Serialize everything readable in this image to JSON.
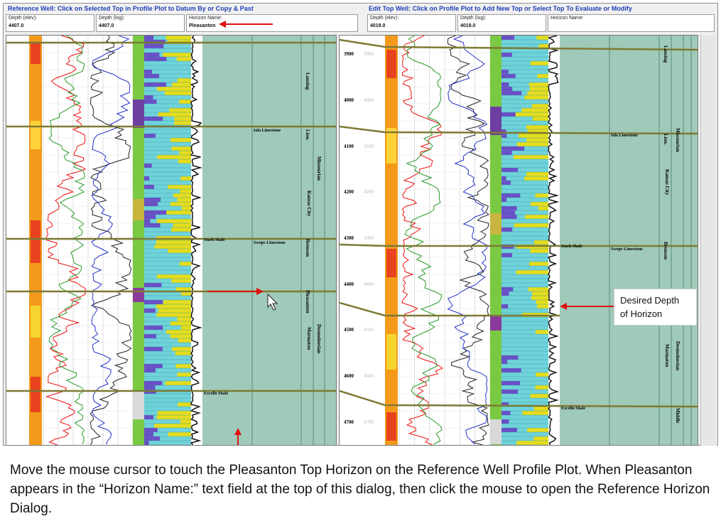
{
  "reference_well": {
    "title": "Reference Well: Click on Selected Top in Profile Plot to Datum By or Copy & Past",
    "depth_elev_label": "Depth (elev):",
    "depth_elev_value": "4407.0",
    "depth_log_label": "Depth (log):",
    "depth_log_value": "4407.0",
    "horizon_label": "Horizon Name:",
    "horizon_value": "Pleasanton",
    "formation_labels": [
      "Iola Limestone",
      "Stark Shale",
      "Swope Limestone",
      "Excello Shale"
    ],
    "vertical_labels": [
      "Lansing",
      "Lion.",
      "Missourian",
      "Kansas City",
      "Bronson",
      "Pleasanton",
      "Desmoinesian",
      "Marmaton"
    ]
  },
  "edit_top_well": {
    "title": "Edit Top Well: Click on Profile Plot to Add New Top or Select Top To Evaluate or Modify",
    "depth_elev_label": "Depth (elev):",
    "depth_elev_value": "4019.0",
    "depth_log_label": "Depth (log):",
    "depth_log_value": "4019.0",
    "horizon_label": "Horizon Name:",
    "horizon_value": "",
    "depth_ticks": [
      "3900",
      "4000",
      "4100",
      "4200",
      "4300",
      "4400",
      "4500",
      "4600",
      "4700"
    ],
    "formation_labels": [
      "Iola Limestone",
      "Stark Shale",
      "Swope Limestone",
      "Excello Shale"
    ],
    "vertical_labels": [
      "Lansing",
      "Lion.",
      "Missourian",
      "Kansas City",
      "Bronson",
      "Desmoinesian",
      "Marmaton",
      "Middle"
    ]
  },
  "callout": {
    "line1": "Desired Depth",
    "line2": "of Horizon"
  },
  "instructions": "Move the mouse cursor to touch the Pleasanton Top Horizon  on the Reference Well Profile Plot.  When Pleasanton appears in the “Horizon Name:” text field at the top of this dialog, then click the mouse to open the Reference Horizon Dialog.",
  "colors": {
    "panel_title": "#1f3fb4",
    "horizon_fill": "#9fc9b8",
    "horizon_line": "#7d7a34",
    "annotation_arrow": "#e01010"
  },
  "icons": {
    "cursor": "arrow-pointer-icon"
  }
}
